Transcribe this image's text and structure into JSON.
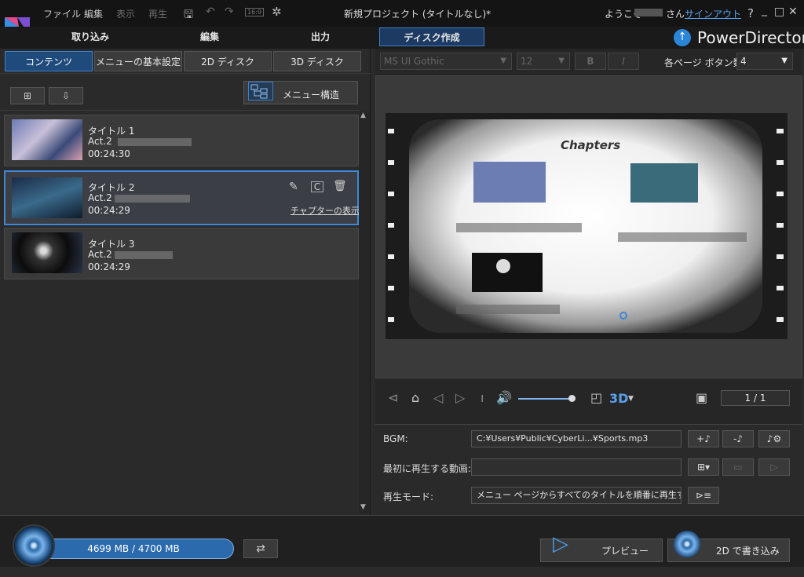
{
  "titlebar": {
    "menu": [
      "ファイル",
      "編集",
      "表示",
      "再生"
    ],
    "aspect": "16:9",
    "window_title": "新規プロジェクト (タイトルなし)*",
    "welcome": "ようこそ",
    "san": "さん",
    "signout": "サインアウト",
    "help": "?",
    "window_controls": [
      "_",
      "□",
      "✕"
    ]
  },
  "modes": [
    "取り込み",
    "編集",
    "出力",
    "ディスク作成"
  ],
  "brand": "PowerDirector",
  "left_tabs": [
    "コンテンツ",
    "メニューの基本設定",
    "2D ディスク",
    "3D ディスク"
  ],
  "menu_structure_label": "メニュー構造",
  "titles": [
    {
      "name": "タイトル 1",
      "act": "Act.2",
      "duration": "00:24:30"
    },
    {
      "name": "タイトル 2",
      "act": "Act.2",
      "duration": "00:24:29",
      "chapter_link": "チャプターの表示"
    },
    {
      "name": "タイトル 3",
      "act": "Act.2",
      "duration": "00:24:29"
    }
  ],
  "font": {
    "family": "MS UI Gothic",
    "size": "12",
    "bold": "B",
    "italic": "I"
  },
  "buttons_per_page_label": "各ページ ボタン数:",
  "buttons_per_page": "4",
  "preview": {
    "title": "Chapters"
  },
  "playback": {
    "page": "1 / 1",
    "mode3d": "3D"
  },
  "bgm": {
    "label": "BGM:",
    "value": "C:¥Users¥Public¥CyberLi...¥Sports.mp3"
  },
  "first_play": {
    "label": "最初に再生する動画:",
    "value": ""
  },
  "play_mode": {
    "label": "再生モード:",
    "value": "メニュー ページからすべてのタイトルを順番に再生する"
  },
  "disc_capacity": "4699 MB / 4700 MB",
  "preview_button": "プレビュー",
  "burn_button": "2D で書き込み",
  "colors": {
    "accent": "#3f87d6",
    "brand_blue": "#2b86d9"
  }
}
